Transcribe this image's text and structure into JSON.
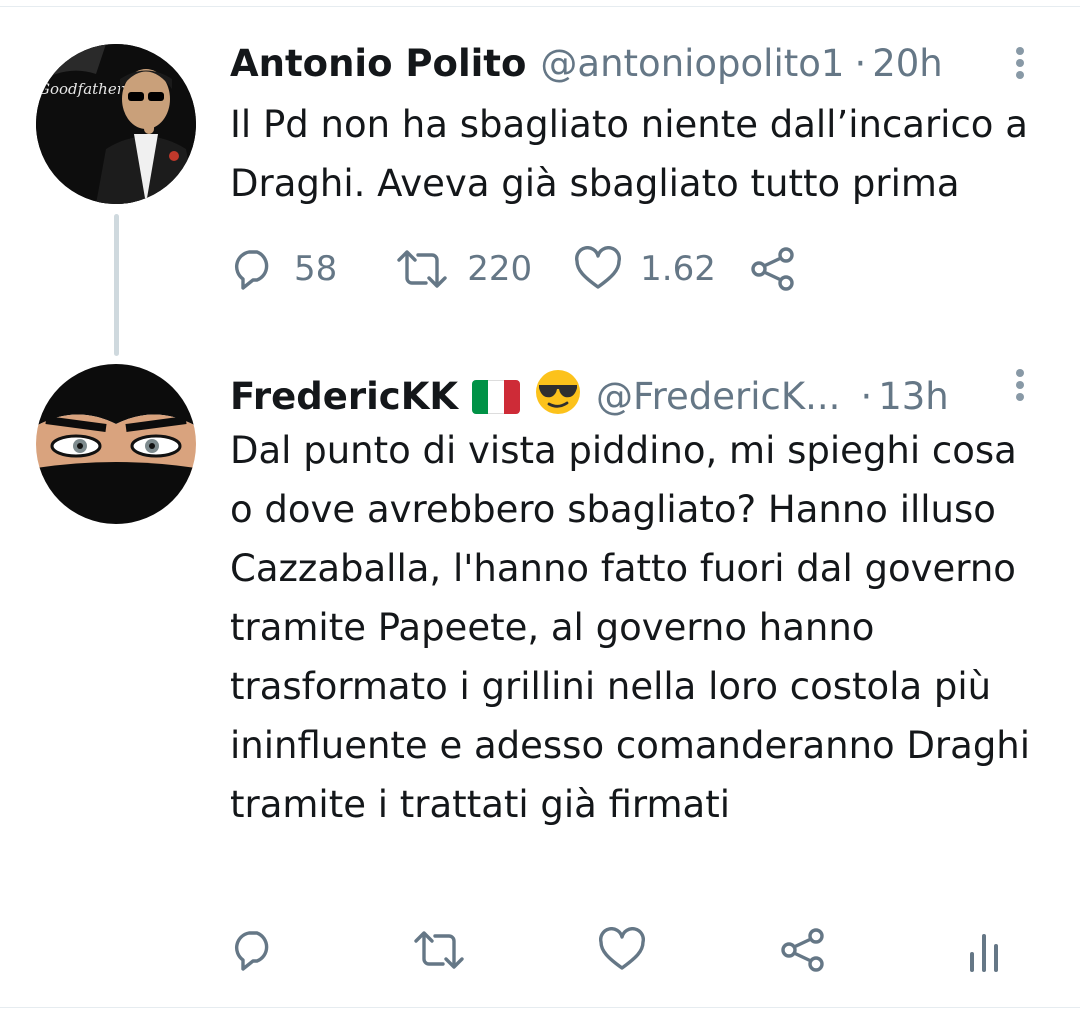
{
  "tweets": [
    {
      "author_name": "Antonio Polito",
      "handle": "@antoniopolito1",
      "separator": "·",
      "time": "20h",
      "avatar_text": "Goodfather",
      "text": "Il Pd non ha sbagliato niente dall’incarico a Draghi. Aveva già sbagliato tutto prima",
      "stats": {
        "replies": "58",
        "retweets": "220",
        "likes": "1.62"
      }
    },
    {
      "author_name": "FredericKK",
      "name_badges": [
        "italian-flag-emoji",
        "sunglasses-emoji"
      ],
      "handle": "@FredericK...",
      "separator": "·",
      "time": "13h",
      "text": "Dal punto di vista piddino, mi spieghi cosa o dove avrebbero sbagliato? Hanno illuso Cazzaballa, l'hanno fatto fuori dal governo tramite Papeete, al governo hanno trasformato i grillini nella loro costola più ininfluente e adesso comanderanno Draghi tramite i trattati già firmati"
    }
  ],
  "colors": {
    "text": "#14171a",
    "secondary": "#657786",
    "thread_line": "#cfd9de",
    "flag_green": "#009246",
    "flag_white": "#ffffff",
    "flag_red": "#ce2b37"
  }
}
